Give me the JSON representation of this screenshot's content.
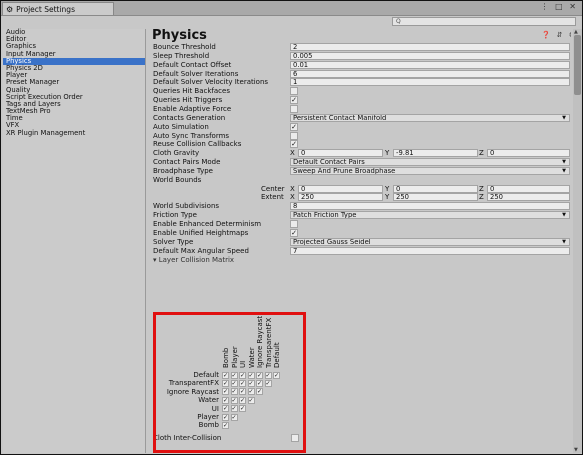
{
  "window": {
    "tab_title": "Project Settings",
    "controls": "⋮ □ ✕",
    "search_placeholder": "Q"
  },
  "sidebar": {
    "items": [
      {
        "label": "Audio",
        "selected": false
      },
      {
        "label": "Editor",
        "selected": false
      },
      {
        "label": "Graphics",
        "selected": false
      },
      {
        "label": "Input Manager",
        "selected": false
      },
      {
        "label": "Physics",
        "selected": true
      },
      {
        "label": "Physics 2D",
        "selected": false
      },
      {
        "label": "Player",
        "selected": false
      },
      {
        "label": "Preset Manager",
        "selected": false
      },
      {
        "label": "Quality",
        "selected": false
      },
      {
        "label": "Script Execution Order",
        "selected": false
      },
      {
        "label": "Tags and Layers",
        "selected": false
      },
      {
        "label": "TextMesh Pro",
        "selected": false
      },
      {
        "label": "Time",
        "selected": false
      },
      {
        "label": "VFX",
        "selected": false
      },
      {
        "label": "XR Plugin Management",
        "selected": false
      }
    ]
  },
  "main": {
    "title": "Physics",
    "header_icons": "❓ ⇵ ⚙",
    "rows": [
      {
        "label": "Bounce Threshold",
        "type": "text",
        "value": "2"
      },
      {
        "label": "Sleep Threshold",
        "type": "text",
        "value": "0.005"
      },
      {
        "label": "Default Contact Offset",
        "type": "text",
        "value": "0.01"
      },
      {
        "label": "Default Solver Iterations",
        "type": "text",
        "value": "6"
      },
      {
        "label": "Default Solver Velocity Iterations",
        "type": "text",
        "value": "1"
      },
      {
        "label": "Queries Hit Backfaces",
        "type": "check",
        "value": ""
      },
      {
        "label": "Queries Hit Triggers",
        "type": "check",
        "value": "✓"
      },
      {
        "label": "Enable Adaptive Force",
        "type": "check",
        "value": ""
      },
      {
        "label": "Contacts Generation",
        "type": "dropdown",
        "value": "Persistent Contact Manifold"
      },
      {
        "label": "Auto Simulation",
        "type": "check",
        "value": "✓"
      },
      {
        "label": "Auto Sync Transforms",
        "type": "check",
        "value": ""
      },
      {
        "label": "Reuse Collision Callbacks",
        "type": "check",
        "value": "✓"
      },
      {
        "label": "Cloth Gravity",
        "type": "vec3",
        "x": "0",
        "y": "-9.81",
        "z": "0"
      },
      {
        "label": "Contact Pairs Mode",
        "type": "dropdown",
        "value": "Default Contact Pairs"
      },
      {
        "label": "Broadphase Type",
        "type": "dropdown",
        "value": "Sweep And Prune Broadphase"
      },
      {
        "label": "World Bounds",
        "type": "header",
        "value": ""
      },
      {
        "label": "Center",
        "type": "vec3sub",
        "x": "0",
        "y": "0",
        "z": "0"
      },
      {
        "label": "Extent",
        "type": "vec3sub",
        "x": "250",
        "y": "250",
        "z": "250"
      },
      {
        "label": "World Subdivisions",
        "type": "text",
        "value": "8"
      },
      {
        "label": "Friction Type",
        "type": "dropdown",
        "value": "Patch Friction Type"
      },
      {
        "label": "Enable Enhanced Determinism",
        "type": "check",
        "value": ""
      },
      {
        "label": "Enable Unified Heightmaps",
        "type": "check",
        "value": "✓"
      },
      {
        "label": "Solver Type",
        "type": "dropdown",
        "value": "Projected Gauss Seidel"
      },
      {
        "label": "Default Max Angular Speed",
        "type": "text",
        "value": "7"
      }
    ],
    "vec_labels": {
      "x": "X",
      "y": "Y",
      "z": "Z"
    },
    "collision_title": "▾ Layer Collision Matrix",
    "matrix": {
      "columns": [
        "Default",
        "TransparentFX",
        "Ignore Raycast",
        "Water",
        "UI",
        "Player",
        "Bomb"
      ],
      "rows": [
        "Default",
        "TransparentFX",
        "Ignore Raycast",
        "Water",
        "UI",
        "Player",
        "Bomb"
      ],
      "checked": "✓"
    },
    "cloth_inter_collision": {
      "label": "Cloth Inter-Collision",
      "value": ""
    }
  }
}
